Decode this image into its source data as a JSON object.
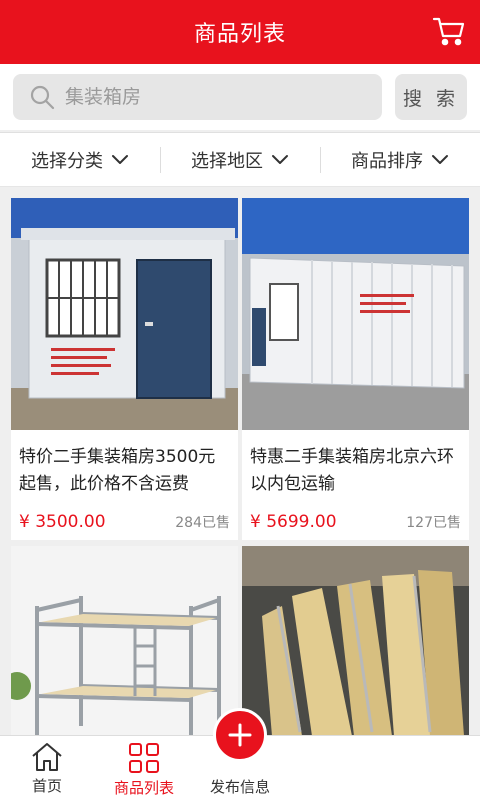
{
  "header": {
    "title": "商品列表",
    "cart_icon": "cart-icon"
  },
  "search": {
    "placeholder": "集装箱房",
    "button_label": "搜 索"
  },
  "filters": [
    {
      "label": "选择分类"
    },
    {
      "label": "选择地区"
    },
    {
      "label": "商品排序"
    }
  ],
  "products": [
    {
      "name": "特价二手集装箱房3500元起售，此价格不含运费",
      "price": "¥ 3500.00",
      "sold": "284已售"
    },
    {
      "name": "特惠二手集装箱房北京六环以内包运输",
      "price": "¥ 5699.00",
      "sold": "127已售"
    },
    {
      "name": "",
      "price": "",
      "sold": ""
    },
    {
      "name": "",
      "price": "",
      "sold": ""
    }
  ],
  "tabbar": {
    "items": [
      {
        "label": "首页"
      },
      {
        "label": "商品列表"
      },
      {
        "label": "发布信息"
      }
    ]
  },
  "colors": {
    "brand": "#e8121d",
    "background": "#efefef"
  }
}
